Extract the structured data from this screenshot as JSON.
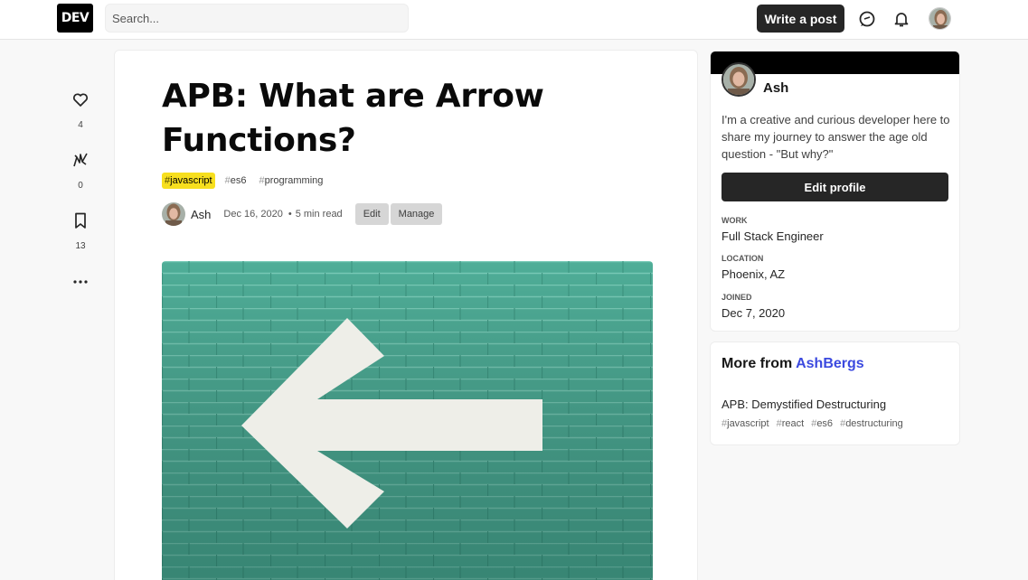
{
  "header": {
    "logo": "DEV",
    "search_placeholder": "Search...",
    "write_post": "Write a post"
  },
  "rail": {
    "likes": "4",
    "unicorns": "0",
    "bookmarks": "13"
  },
  "article": {
    "title": "APB: What are Arrow Functions?",
    "tags": [
      {
        "hash": "#",
        "name": "javascript",
        "bg": "#f7df1e"
      },
      {
        "hash": "#",
        "name": "es6"
      },
      {
        "hash": "#",
        "name": "programming"
      }
    ],
    "author": "Ash",
    "date": "Dec 16, 2020",
    "sep": "•",
    "read_time": "5 min read",
    "edit": "Edit",
    "manage": "Manage",
    "cover_colors": {
      "wall": "#4fae98",
      "arrow": "#eeeee8"
    }
  },
  "profile": {
    "name": "Ash",
    "bio": "I'm a creative and curious developer here to share my journey to answer the age old question - \"But why?\"",
    "edit_profile": "Edit profile",
    "work_label": "Work",
    "work": "Full Stack Engineer",
    "location_label": "Location",
    "location": "Phoenix, AZ",
    "joined_label": "Joined",
    "joined": "Dec 7, 2020"
  },
  "more_from": {
    "prefix": "More from",
    "org": "AshBergs",
    "post_title": "APB: Demystified Destructuring",
    "post_tags": [
      {
        "hash": "#",
        "name": "javascript"
      },
      {
        "hash": "#",
        "name": "react"
      },
      {
        "hash": "#",
        "name": "es6"
      },
      {
        "hash": "#",
        "name": "destructuring"
      }
    ]
  },
  "colors": {
    "accent": "#3b49df",
    "dark_button": "#262626"
  }
}
